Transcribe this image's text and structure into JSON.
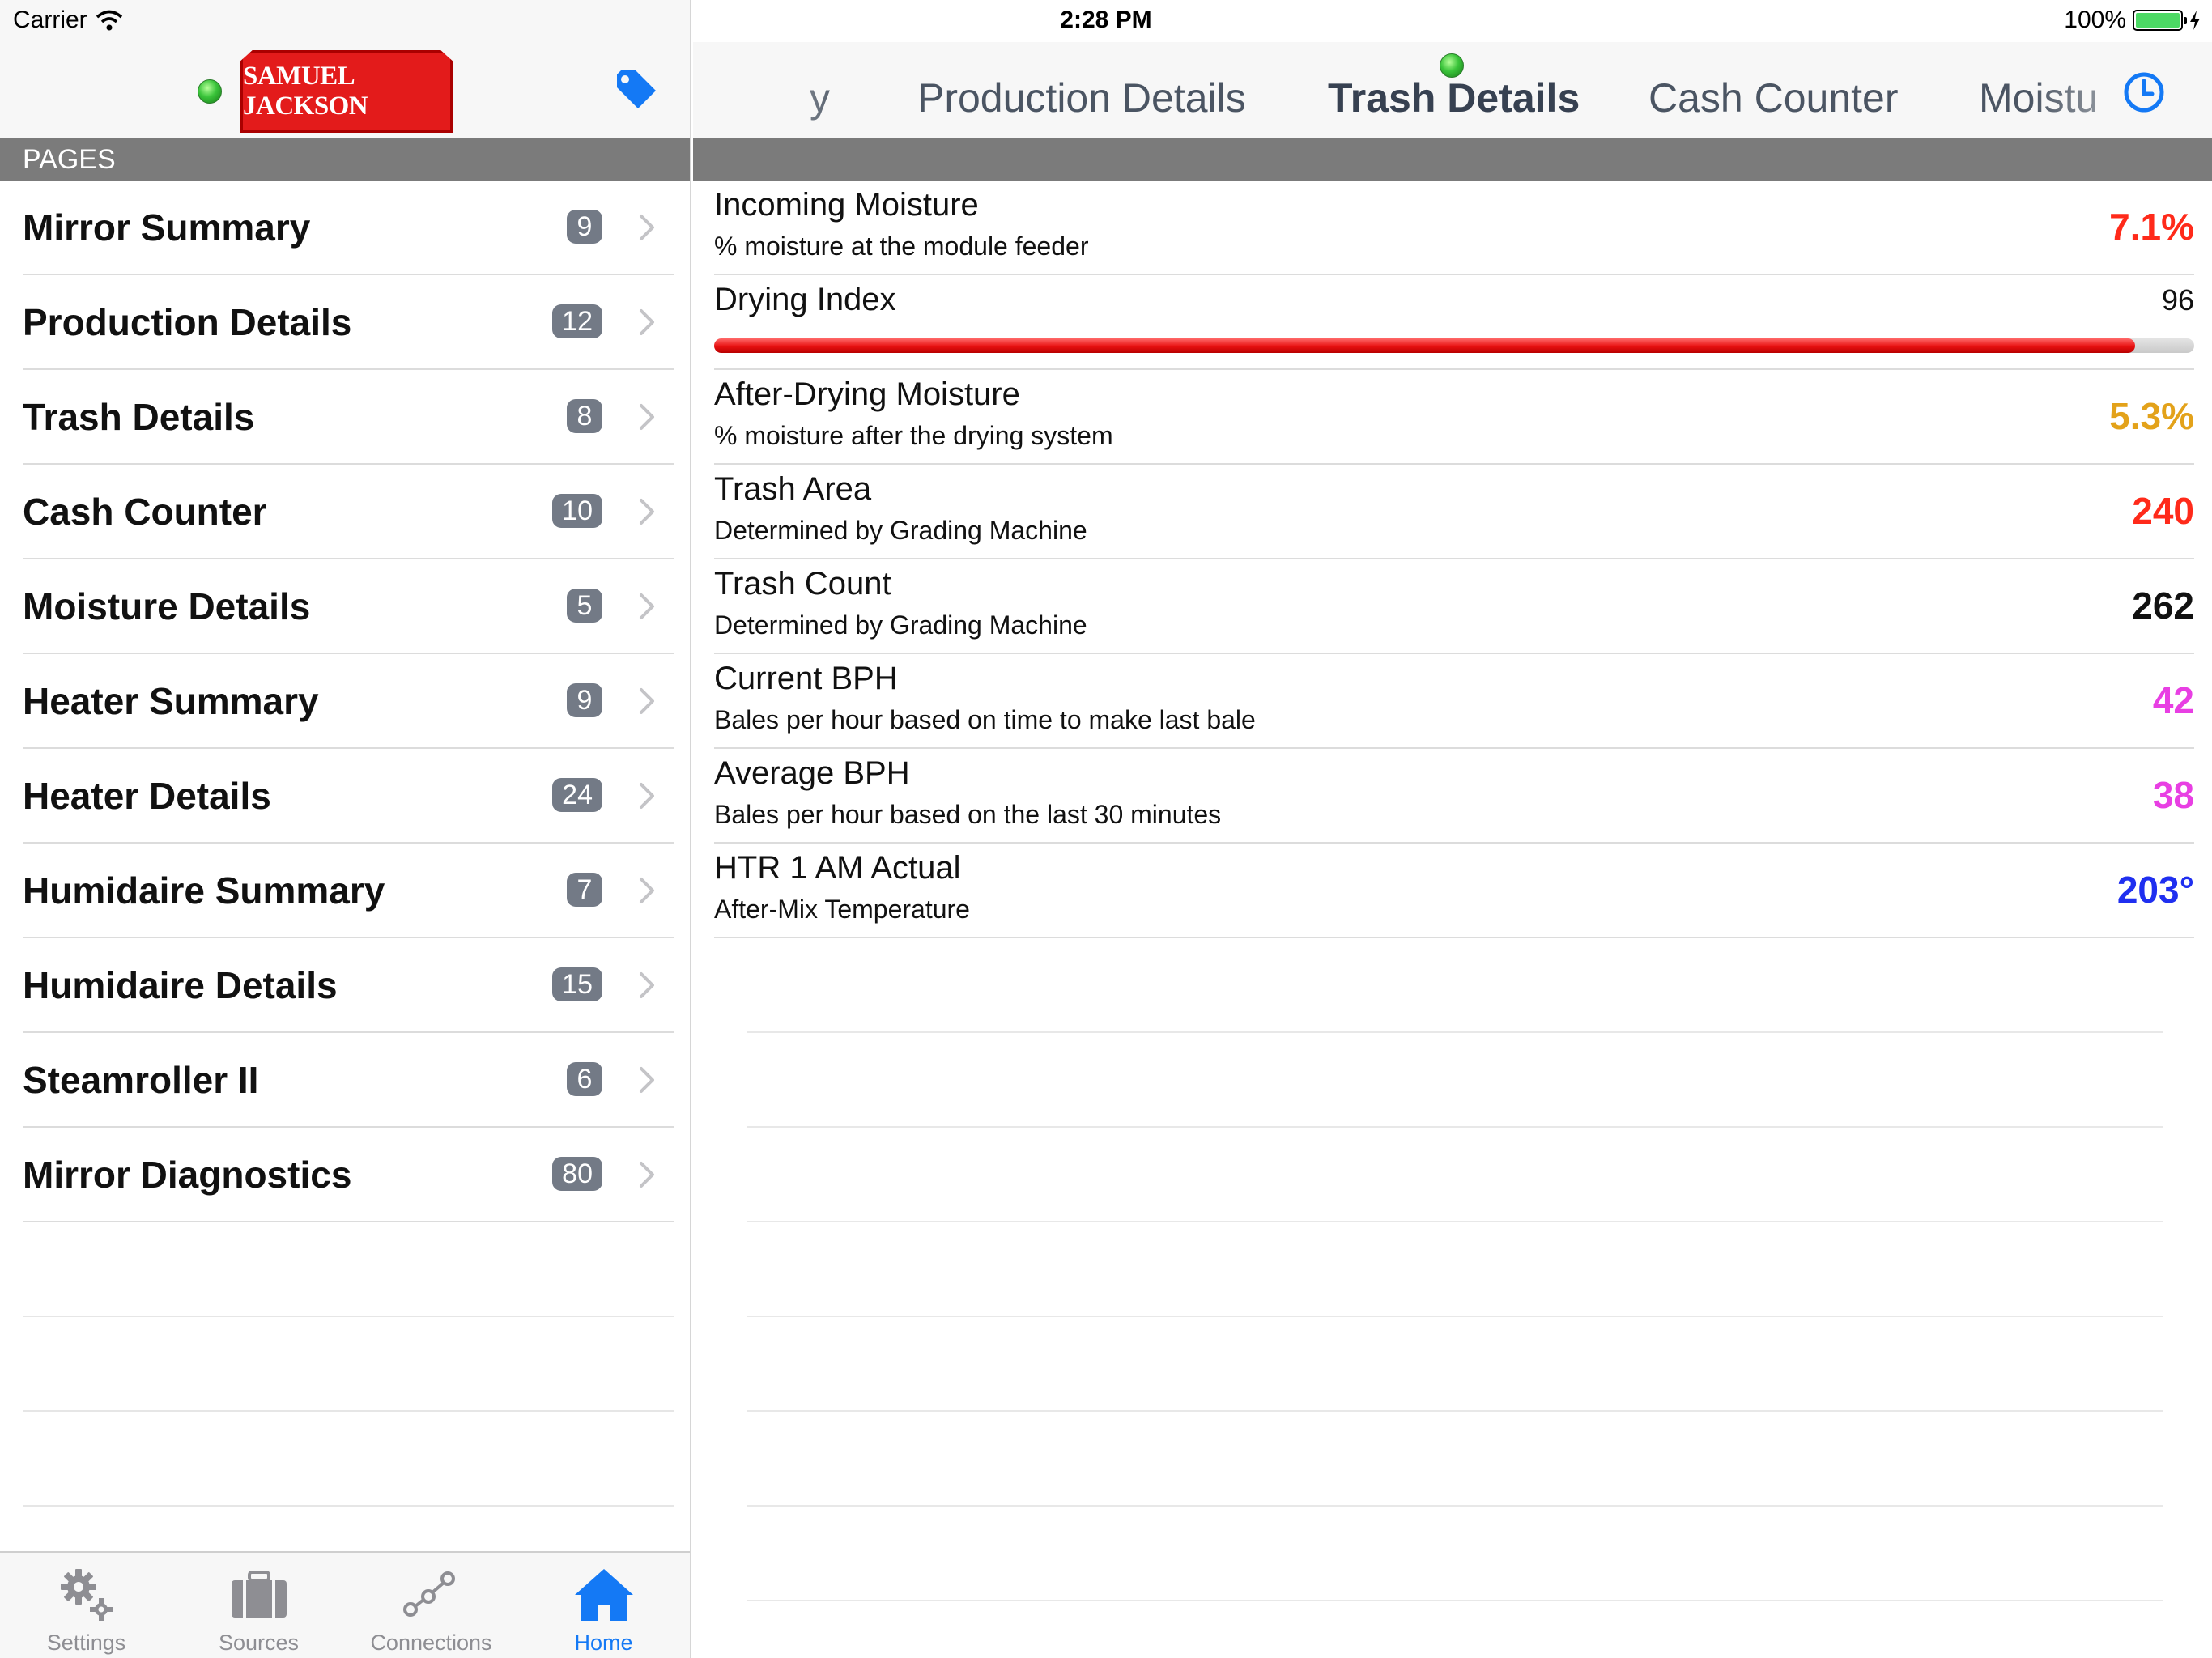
{
  "status_bar": {
    "carrier": "Carrier",
    "time": "2:28 PM",
    "battery": "100%"
  },
  "sidebar": {
    "logo_text": "SAMUEL JACKSON",
    "section_title": "PAGES",
    "pages": [
      {
        "label": "Mirror Summary",
        "count": "9"
      },
      {
        "label": "Production Details",
        "count": "12"
      },
      {
        "label": "Trash Details",
        "count": "8"
      },
      {
        "label": "Cash Counter",
        "count": "10"
      },
      {
        "label": "Moisture Details",
        "count": "5"
      },
      {
        "label": "Heater Summary",
        "count": "9"
      },
      {
        "label": "Heater Details",
        "count": "24"
      },
      {
        "label": "Humidaire Summary",
        "count": "7"
      },
      {
        "label": "Humidaire Details",
        "count": "15"
      },
      {
        "label": "Steamroller II",
        "count": "6"
      },
      {
        "label": "Mirror Diagnostics",
        "count": "80"
      }
    ]
  },
  "tab_bar": {
    "tabs": [
      {
        "label": "Settings",
        "icon": "gears-icon",
        "active": false
      },
      {
        "label": "Sources",
        "icon": "briefcase-icon",
        "active": false
      },
      {
        "label": "Connections",
        "icon": "connections-icon",
        "active": false
      },
      {
        "label": "Home",
        "icon": "home-icon",
        "active": true
      }
    ],
    "active_color": "#1479f5",
    "inactive_color": "#8e8e93"
  },
  "detail": {
    "nav_tabs": [
      {
        "label": "y",
        "current": false
      },
      {
        "label": "Production Details",
        "current": false
      },
      {
        "label": "Trash Details",
        "current": true
      },
      {
        "label": "Cash Counter",
        "current": false
      },
      {
        "label": "Moistu",
        "current": false
      }
    ],
    "metrics_top": {
      "title": "Incoming Moisture",
      "subtitle": "% moisture at the module feeder",
      "value": "7.1%",
      "color": "#ff2a1a"
    },
    "gauge": {
      "title": "Drying Index",
      "value": "96",
      "fraction": 0.96,
      "color": "#e81010"
    },
    "metrics": [
      {
        "title": "After-Drying Moisture",
        "subtitle": "% moisture after the drying system",
        "value": "5.3%",
        "color": "#e3a21a"
      },
      {
        "title": "Trash Area",
        "subtitle": "Determined by Grading Machine",
        "value": "240",
        "color": "#ff2a1a"
      },
      {
        "title": "Trash Count",
        "subtitle": "Determined by Grading Machine",
        "value": "262",
        "color": "#111111"
      },
      {
        "title": "Current BPH",
        "subtitle": "Bales per hour based on time to make last bale",
        "value": "42",
        "color": "#e83fe3"
      },
      {
        "title": "Average BPH",
        "subtitle": "Bales per hour based on the last 30 minutes",
        "value": "38",
        "color": "#e83fe3"
      },
      {
        "title": "HTR 1 AM Actual",
        "subtitle": "After-Mix Temperature",
        "value": "203°",
        "color": "#1f2ff0"
      }
    ]
  }
}
